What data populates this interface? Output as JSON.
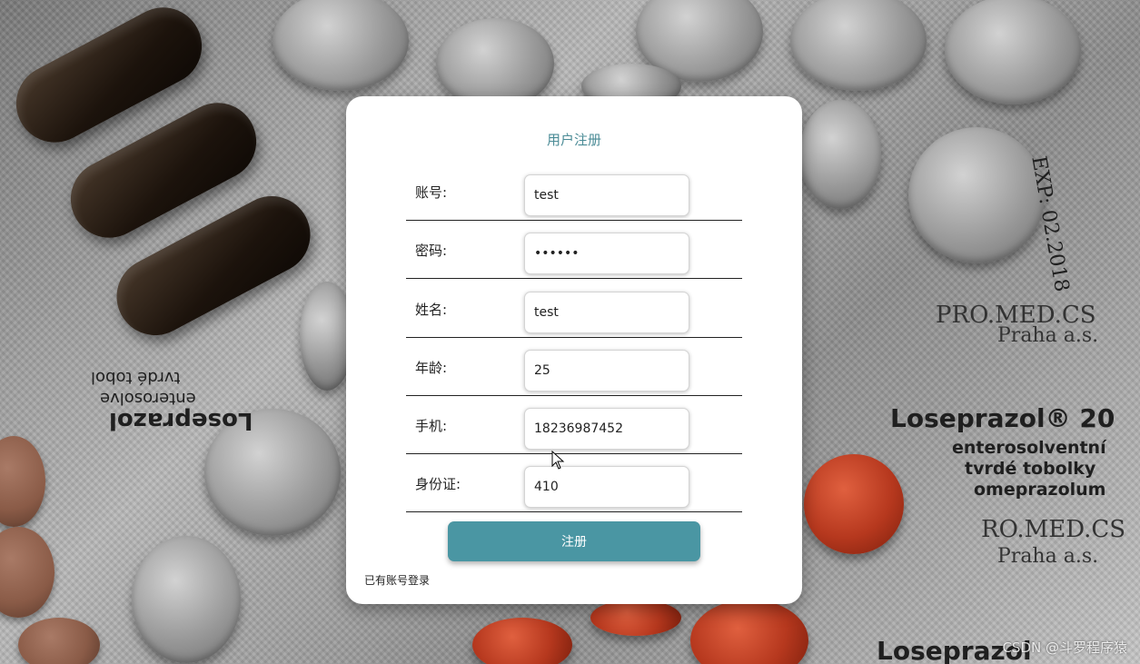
{
  "form": {
    "title": "用户注册",
    "fields": [
      {
        "label": "账号:",
        "value": "test"
      },
      {
        "label": "密码:",
        "value": "••••••"
      },
      {
        "label": "姓名:",
        "value": "test"
      },
      {
        "label": "年龄:",
        "value": "25"
      },
      {
        "label": "手机:",
        "value": "18236987452"
      },
      {
        "label": "身份证:",
        "value": "410"
      }
    ],
    "submit_label": "注册",
    "login_link": "已有账号登录"
  },
  "background": {
    "foil_texts": [
      "EXP: 02.2018",
      "PRO.MED.CS",
      "Praha a.s.",
      "Loseprazol® 20",
      "enterosolventní",
      "tvrdé tobolky",
      "omeprazolum",
      "RO.MED.CS",
      "Praha a.s.",
      "Loseprazol",
      "Loseprazol",
      "enterosolve",
      "tvrdé tobol"
    ]
  },
  "watermark": "CSDN @斗罗程序猿",
  "colors": {
    "accent": "#4a96a3",
    "title": "#4a8b96"
  }
}
